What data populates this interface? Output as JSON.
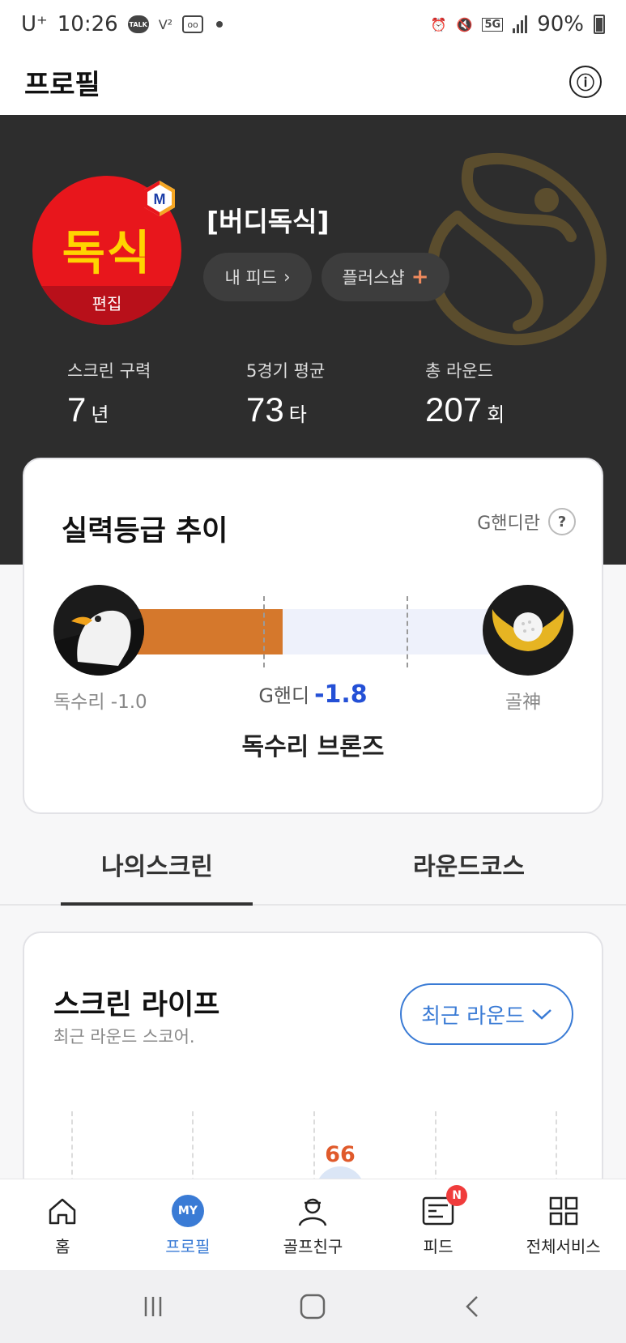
{
  "status_bar": {
    "carrier": "U⁺",
    "time": "10:26",
    "talk_icon_text": "TALK",
    "network": "5G",
    "battery": "90%"
  },
  "header": {
    "title": "프로필",
    "info_icon": "ⓘ"
  },
  "profile": {
    "avatar_text": "독식",
    "avatar_edit_label": "편집",
    "badge_letter": "M",
    "nickname": "[버디독식]",
    "feed_button_label": "내 피드",
    "plus_shop_label": "플러스샵"
  },
  "stats": [
    {
      "label": "스크린 구력",
      "value": "7",
      "unit": "년"
    },
    {
      "label": "5경기 평균",
      "value": "73",
      "unit": "타"
    },
    {
      "label": "총 라운드",
      "value": "207",
      "unit": "회"
    }
  ],
  "grade_card": {
    "title": "실력등급 추이",
    "help_link_label": "G핸디란",
    "help_icon": "?",
    "left_grade_label": "독수리 -1.0",
    "right_grade_label": "골神",
    "current_prefix": "G핸디",
    "current_value": "-1.8",
    "current_grade_name": "독수리 브론즈",
    "progress_fraction": 0.41,
    "fill_color": "#d5782c"
  },
  "tabs": [
    {
      "label": "나의스크린",
      "active": true
    },
    {
      "label": "라운드코스",
      "active": false
    }
  ],
  "screen_life": {
    "title": "스크린 라이프",
    "subtitle": "최근 라운드 스코어.",
    "dropdown_label": "최근 라운드",
    "visible_score": "66",
    "score_color": "#e05a2b"
  },
  "bottom_nav": [
    {
      "label": "홈",
      "icon": "home-icon"
    },
    {
      "label": "프로필",
      "icon": "my-icon",
      "icon_text": "MY",
      "active": true
    },
    {
      "label": "골프친구",
      "icon": "person-icon"
    },
    {
      "label": "피드",
      "icon": "feed-icon",
      "badge": "N"
    },
    {
      "label": "전체서비스",
      "icon": "grid-icon"
    }
  ],
  "colors": {
    "accent": "#3a7bd5",
    "hero_bg": "#2d2d2d",
    "avatar_red": "#e8161c"
  }
}
